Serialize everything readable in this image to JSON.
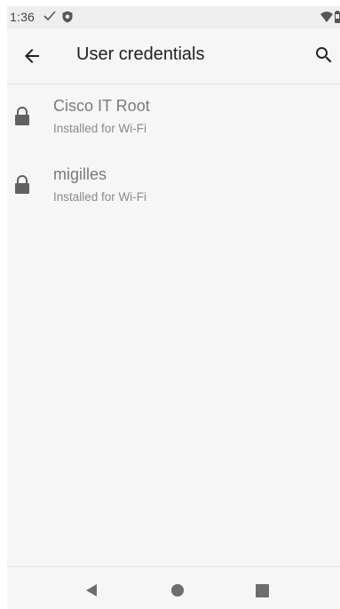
{
  "status_bar": {
    "time": "1:36",
    "icons": [
      "check-icon",
      "shield-icon",
      "wifi-icon",
      "battery-icon"
    ]
  },
  "app_bar": {
    "title": "User credentials",
    "back_icon": "arrow-left-icon",
    "search_icon": "search-icon"
  },
  "credentials": [
    {
      "name": "Cisco IT Root",
      "status": "Installed for Wi-Fi",
      "icon": "lock-icon"
    },
    {
      "name": "migilles",
      "status": "Installed for Wi-Fi",
      "icon": "lock-icon"
    }
  ],
  "nav_bar": {
    "icons": [
      "nav-back-icon",
      "nav-home-icon",
      "nav-recents-icon"
    ]
  },
  "colors": {
    "background": "#f6f6f6",
    "status_bar": "#eeeeee",
    "title_text": "#202124",
    "item_title": "#7a7a7a",
    "item_subtitle": "#8a8a8a",
    "icon": "#616161"
  }
}
